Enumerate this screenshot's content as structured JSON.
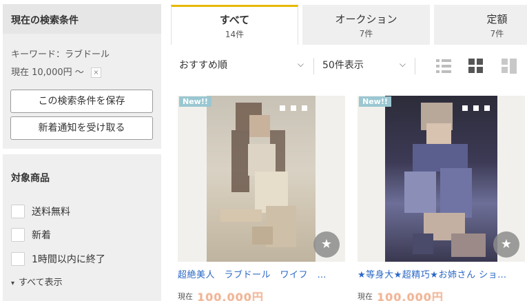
{
  "sidebar": {
    "search_panel": {
      "heading": "現在の検索条件",
      "keyword_line": "キーワード：ラブドール",
      "price_line": "現在 10,000円 〜",
      "clear_symbol": "×",
      "save_button": "この検索条件を保存",
      "notify_button": "新着通知を受け取る"
    },
    "filter_panel": {
      "heading": "対象商品",
      "options": [
        {
          "label": "送料無料",
          "checked": false
        },
        {
          "label": "新着",
          "checked": false
        },
        {
          "label": "1時間以内に終了",
          "checked": false
        }
      ],
      "show_all": "すべて表示"
    }
  },
  "tabs": [
    {
      "label": "すべて",
      "count": "14件",
      "active": true
    },
    {
      "label": "オークション",
      "count": "7件",
      "active": false
    },
    {
      "label": "定額",
      "count": "7件",
      "active": false
    }
  ],
  "controls": {
    "sort_selected": "おすすめ順",
    "per_page_selected": "50件表示",
    "views": [
      "list-view-icon",
      "grid-view-icon",
      "large-view-icon"
    ],
    "active_view": "grid-view-icon"
  },
  "products": [
    {
      "badge": "New!!",
      "title": "超絶美人　ラブドール　ワイフ　…",
      "price_label": "現在",
      "price": "100,000円"
    },
    {
      "badge": "New!!",
      "title": "★等身大★超精巧★お姉さん ショ…",
      "price_label": "現在",
      "price": "100,000円"
    }
  ],
  "colors": {
    "accent_tab": "#e6b800",
    "link": "#2a68c6",
    "price": "#e26b2e",
    "badge": "#9ac7d2",
    "panel_bg": "#efefef"
  },
  "icons": {
    "chevron": "⌄",
    "star": "★",
    "down_arrow": "⌄"
  }
}
